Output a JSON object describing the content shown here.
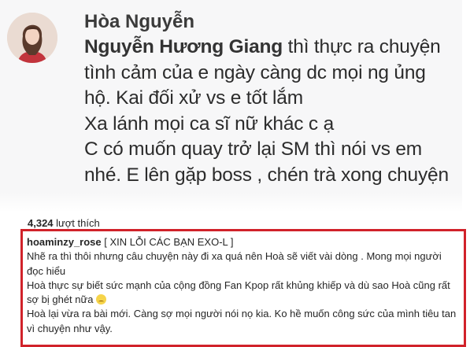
{
  "comment": {
    "author": "Hòa Nguyễn",
    "mention": "Nguyễn Hương Giang",
    "lines": [
      " thì thực ra chuyện",
      "tình cảm của e ngày càng dc mọi ng ủng",
      "hộ. Kai đối xử vs e tốt lắm",
      "Xa lánh mọi ca sĩ nữ khác c ạ",
      "C có muốn quay trở lại SM thì nói vs em",
      "nhé. E lên gặp boss , chén trà xong chuyện"
    ]
  },
  "post": {
    "likes_count": "4,324",
    "likes_word": "lượt thích",
    "username": "hoaminzy_rose",
    "caption_title": " [ XIN LỖI CÁC BẠN EXO-L ]",
    "caption_paragraphs": [
      "Nhẽ ra thì thôi nhưng câu chuyện này đi xa quá nên Hoà sẽ viết vài dòng . Mong mọi người đọc hiểu",
      "Hoà thực sự biết sức mạnh của cộng đồng Fan Kpop rất khủng khiếp và dù sao Hoà cũng rất sợ bị ghét nữa ",
      "Hoà lại vừa ra bài mới. Càng sợ mọi người nói nọ kia. Ko hề muốn công sức của mình tiêu tan vì chuyện như vậy."
    ]
  },
  "icons": {
    "avatar": "profile-photo",
    "emoji": "worried-face-emoji"
  },
  "colors": {
    "highlight_border": "#d1222a"
  }
}
